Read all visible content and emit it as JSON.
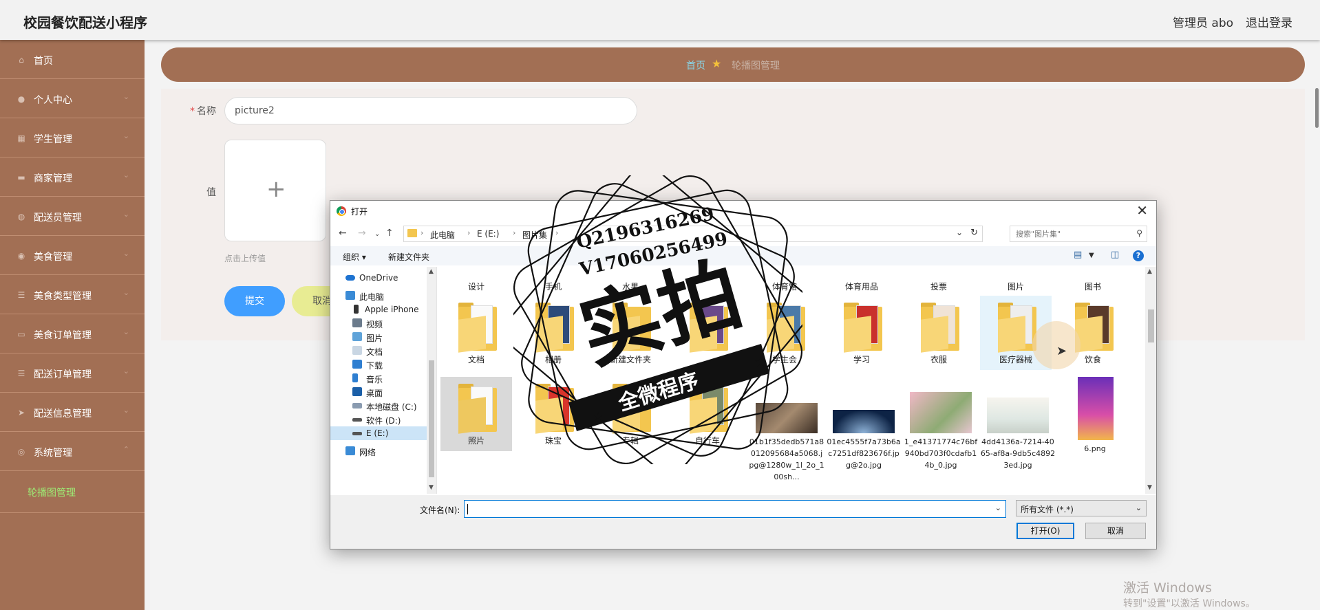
{
  "header": {
    "app_title": "校园餐饮配送小程序",
    "admin_label": "管理员 abo",
    "logout_label": "退出登录"
  },
  "sidebar": {
    "items": [
      {
        "label": "首页",
        "icon": "home-icon"
      },
      {
        "label": "个人中心",
        "icon": "user-icon"
      },
      {
        "label": "学生管理",
        "icon": "grid-icon"
      },
      {
        "label": "商家管理",
        "icon": "store-icon"
      },
      {
        "label": "配送员管理",
        "icon": "courier-icon"
      },
      {
        "label": "美食管理",
        "icon": "food-icon"
      },
      {
        "label": "美食类型管理",
        "icon": "list-icon"
      },
      {
        "label": "美食订单管理",
        "icon": "order-icon"
      },
      {
        "label": "配送订单管理",
        "icon": "delivery-order-icon"
      },
      {
        "label": "配送信息管理",
        "icon": "send-icon"
      },
      {
        "label": "系统管理",
        "icon": "system-icon"
      }
    ],
    "sub_item": "轮播图管理"
  },
  "breadcrumb": {
    "home": "首页",
    "current": "轮播图管理"
  },
  "form": {
    "name_label": "名称",
    "name_value": "picture2",
    "value_label": "值",
    "upload_hint": "点击上传值",
    "submit_label": "提交",
    "cancel_label": "取消"
  },
  "dialog": {
    "title": "打开",
    "path": [
      "此电脑",
      "E (E:)",
      "图片集"
    ],
    "search_placeholder": "搜索\"图片集\"",
    "toolbar": {
      "organize": "组织 ▾",
      "new_folder": "新建文件夹"
    },
    "nav_items": [
      "OneDrive",
      "此电脑",
      "Apple iPhone",
      "视频",
      "图片",
      "文档",
      "下载",
      "音乐",
      "桌面",
      "本地磁盘 (C:)",
      "软件 (D:)",
      "E (E:)",
      "网络"
    ],
    "top_row_names": [
      "设计",
      "手机",
      "水果",
      "体育馆",
      "体育用品",
      "投票",
      "图片",
      "图书"
    ],
    "row2_names": [
      "文档",
      "相册",
      "新建文件夹",
      "学生会",
      "学习",
      "衣服",
      "医疗器械",
      "饮食"
    ],
    "row3_folders": [
      "照片",
      "珠宝",
      "专辑",
      "自行车"
    ],
    "row3_images": [
      "01b1f35dedb571a8012095684a5068.jpg@1280w_1l_2o_100sh...",
      "01ec4555f7a73b6ac7251df823676f.jpg@2o.jpg",
      "1_e41371774c76bf940bd703f0cdafb14b_0.jpg",
      "4dd4136a-7214-4065-af8a-9db5c48923ed.jpg",
      "6.png"
    ],
    "filename_label": "文件名(N):",
    "filter_label": "所有文件 (*.*)",
    "open_label": "打开(O)",
    "cancel_label": "取消"
  },
  "watermark": {
    "line1": "Q2196316269",
    "line2": "V17060256499",
    "main": "实拍",
    "ribbon": "全微程序"
  },
  "windows_activation": {
    "line1": "激活 Windows",
    "line2": "转到\"设置\"以激活 Windows。"
  }
}
